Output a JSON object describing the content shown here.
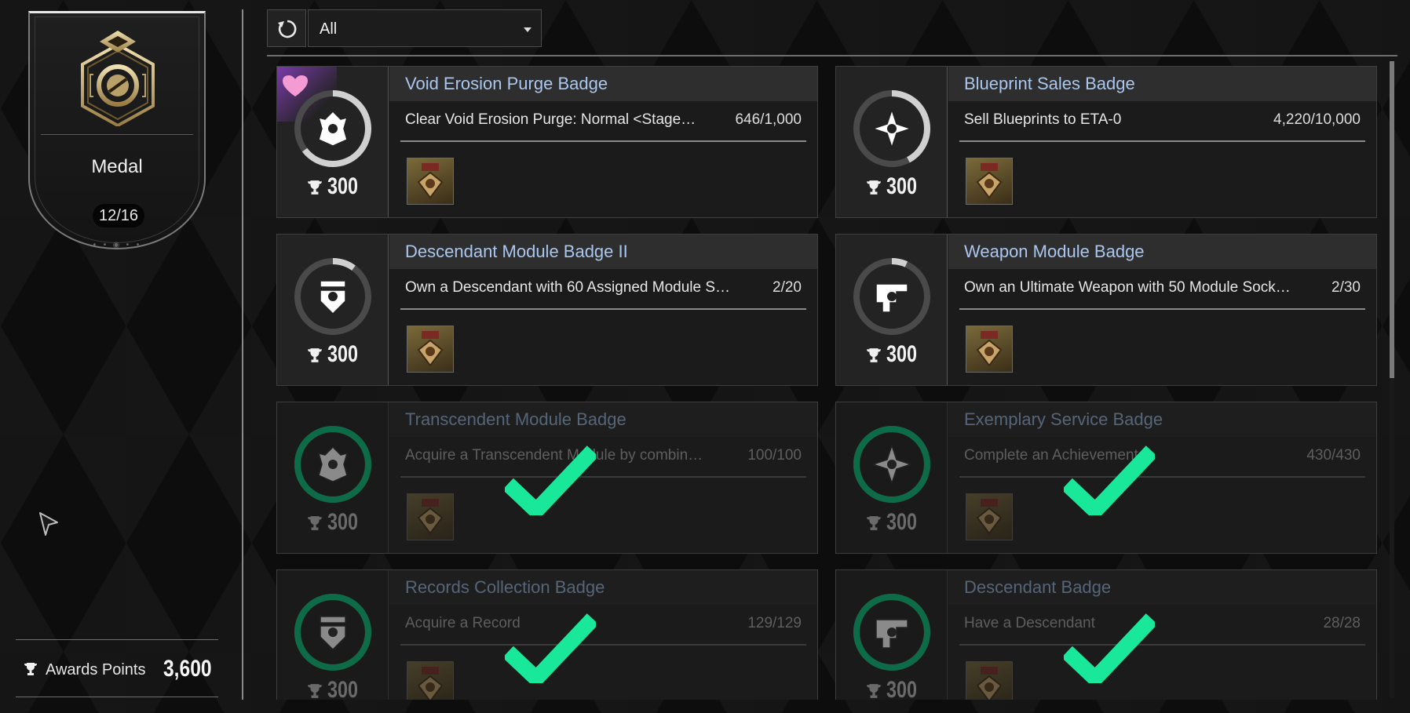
{
  "sidebar": {
    "medal_title": "Medal",
    "medal_count": "12/16",
    "awards_label": "Awards Points",
    "awards_value": "3,600"
  },
  "toolbar": {
    "filter_value": "All"
  },
  "cards": [
    {
      "title": "Void Erosion Purge Badge",
      "desc": "Clear Void Erosion Purge: Normal <Stage…",
      "progress": "646/1,000",
      "points": "300",
      "completed": false,
      "favorite": true,
      "ring_fraction": 0.646
    },
    {
      "title": "Blueprint Sales Badge",
      "desc": "Sell Blueprints to ETA-0",
      "progress": "4,220/10,000",
      "points": "300",
      "completed": false,
      "favorite": false,
      "ring_fraction": 0.422
    },
    {
      "title": "Descendant Module Badge II",
      "desc": "Own a Descendant with 60 Assigned Module So…",
      "progress": "2/20",
      "points": "300",
      "completed": false,
      "favorite": false,
      "ring_fraction": 0.1
    },
    {
      "title": "Weapon Module Badge",
      "desc": "Own an Ultimate Weapon with 50 Module Sock…",
      "progress": "2/30",
      "points": "300",
      "completed": false,
      "favorite": false,
      "ring_fraction": 0.067
    },
    {
      "title": "Transcendent Module Badge",
      "desc": "Acquire a Transcendent Module by combin…",
      "progress": "100/100",
      "points": "300",
      "completed": true,
      "favorite": false,
      "ring_fraction": 1
    },
    {
      "title": "Exemplary Service Badge",
      "desc": "Complete an Achievement",
      "progress": "430/430",
      "points": "300",
      "completed": true,
      "favorite": false,
      "ring_fraction": 1
    },
    {
      "title": "Records Collection Badge",
      "desc": "Acquire a Record",
      "progress": "129/129",
      "points": "300",
      "completed": true,
      "favorite": false,
      "ring_fraction": 1
    },
    {
      "title": "Descendant Badge",
      "desc": "Have a Descendant",
      "progress": "28/28",
      "points": "300",
      "completed": true,
      "favorite": false,
      "ring_fraction": 1
    }
  ],
  "colors": {
    "title_active": "#a9c7f0",
    "check_green": "#19e89a",
    "ring_done": "#0d6b47",
    "ring_progress": "#d0d0d0",
    "ring_track": "#4a4a4a",
    "favorite": "#f39bd2"
  },
  "icons": {
    "refresh": "refresh-icon",
    "trophy": "trophy-icon",
    "check": "check-icon",
    "heart": "heart-icon",
    "cursor": "mouse-cursor-icon"
  }
}
